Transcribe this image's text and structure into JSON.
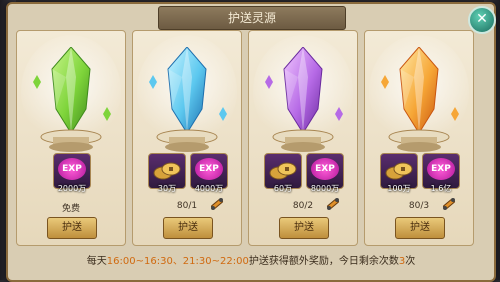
{
  "title": "护送灵源",
  "close_icon": "close-icon",
  "cards": [
    {
      "crystal_color": "green",
      "colors": {
        "light": "#c8f58a",
        "mid": "#7ed43a",
        "dark": "#3f8a1c"
      },
      "items": [
        {
          "type": "exp",
          "label": "EXP",
          "qty": "2000万"
        }
      ],
      "count": "免费",
      "button": "护送"
    },
    {
      "crystal_color": "blue",
      "colors": {
        "light": "#c9f4ff",
        "mid": "#5cc8ef",
        "dark": "#1d6fae"
      },
      "items": [
        {
          "type": "coin",
          "qty": "30万"
        },
        {
          "type": "exp",
          "label": "EXP",
          "qty": "4000万"
        }
      ],
      "count": "80/1",
      "button": "护送"
    },
    {
      "crystal_color": "purple",
      "colors": {
        "light": "#f1c8ff",
        "mid": "#b66ae6",
        "dark": "#6a2a9e"
      },
      "items": [
        {
          "type": "coin",
          "qty": "60万"
        },
        {
          "type": "exp",
          "label": "EXP",
          "qty": "8000万"
        }
      ],
      "count": "80/2",
      "button": "护送"
    },
    {
      "crystal_color": "orange",
      "colors": {
        "light": "#ffe9a6",
        "mid": "#f6a636",
        "dark": "#c9560f"
      },
      "items": [
        {
          "type": "coin",
          "qty": "100万"
        },
        {
          "type": "exp",
          "label": "EXP",
          "qty": "1.6亿"
        }
      ],
      "count": "80/3",
      "button": "护送"
    }
  ],
  "footer": {
    "part1": "每天",
    "time": "16:00~16:30、21:30~22:00",
    "part2": "护送获得额外奖励，今日剩余次数",
    "remaining": "3",
    "part3": "次"
  }
}
